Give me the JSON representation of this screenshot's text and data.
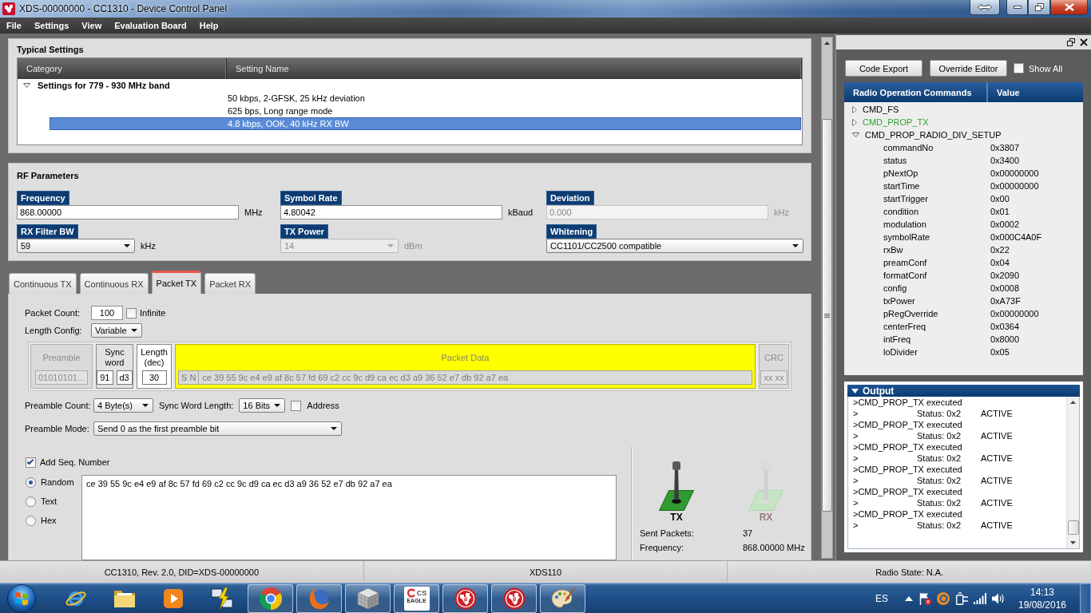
{
  "window": {
    "title": "XDS-00000000 - CC1310 - Device Control Panel"
  },
  "menu": [
    "File",
    "Settings",
    "View",
    "Evaluation Board",
    "Help"
  ],
  "typical_settings": {
    "title": "Typical Settings",
    "columns": [
      "Category",
      "Setting Name"
    ],
    "groups": [
      {
        "label": "Settings for 779 - 930 MHz band",
        "expanded": true,
        "children": [
          {
            "label": "50 kbps, 2-GFSK, 25 kHz deviation",
            "selected": false
          },
          {
            "label": "625 bps, Long range mode",
            "selected": false
          },
          {
            "label": "4.8 kbps, OOK, 40 kHz RX BW",
            "selected": true
          }
        ]
      }
    ]
  },
  "rf_parameters": {
    "title": "RF Parameters",
    "fields": [
      {
        "label": "Frequency",
        "kind": "input",
        "value": "868.00000",
        "unit": "MHz",
        "disabled": false
      },
      {
        "label": "Symbol Rate",
        "kind": "input",
        "value": "4.80042",
        "unit": "kBaud",
        "disabled": false
      },
      {
        "label": "Deviation",
        "kind": "input",
        "value": "0.000",
        "unit": "kHz",
        "disabled": true
      },
      {
        "label": "RX Filter BW",
        "kind": "select",
        "value": "59",
        "unit": "kHz",
        "disabled": false
      },
      {
        "label": "TX Power",
        "kind": "select",
        "value": "14",
        "unit": "dBm",
        "disabled": true
      },
      {
        "label": "Whitening",
        "kind": "select",
        "value": "CC1101/CC2500 compatible",
        "disabled": false
      }
    ]
  },
  "tabs": [
    {
      "label": "Continuous TX",
      "selected": false
    },
    {
      "label": "Continuous RX",
      "selected": false
    },
    {
      "label": "Packet TX",
      "selected": true
    },
    {
      "label": "Packet RX",
      "selected": false
    }
  ],
  "packet_tx": {
    "packet_count": {
      "label": "Packet Count:",
      "value": "100"
    },
    "infinite": {
      "label": "Infinite",
      "checked": false
    },
    "length_config": {
      "label": "Length Config:",
      "value": "Variable"
    },
    "structure": [
      {
        "kind": "preamble",
        "title": "Preamble",
        "values": [
          "01010101..."
        ]
      },
      {
        "kind": "sync",
        "title": "Sync word",
        "values": [
          "91",
          "d3"
        ]
      },
      {
        "kind": "length",
        "title": "Length (dec)",
        "values": [
          "30"
        ]
      },
      {
        "kind": "data",
        "title": "Packet Data",
        "prefix": "S N",
        "values": [
          "ce 39 55 9c e4 e9 af 8c 57 fd 69 c2 cc 9c d9 ca ec d3 a9 36 52 e7 db 92 a7 ea"
        ]
      },
      {
        "kind": "crc",
        "title": "CRC",
        "values": [
          "xx xx"
        ]
      }
    ],
    "preamble_count": {
      "label": "Preamble Count:",
      "value": "4 Byte(s)"
    },
    "sync_word_length": {
      "label": "Sync Word Length:",
      "value": "16 Bits"
    },
    "address": {
      "label": "Address",
      "checked": false
    },
    "preamble_mode": {
      "label": "Preamble Mode:",
      "value": "Send 0 as the first preamble bit"
    },
    "add_seq_number": {
      "label": "Add Seq. Number",
      "checked": true
    },
    "payload_modes": [
      {
        "label": "Random",
        "selected": true
      },
      {
        "label": "Text",
        "selected": false
      },
      {
        "label": "Hex",
        "selected": false
      }
    ],
    "payload": "ce 39 55 9c e4 e9 af 8c 57 fd 69 c2 cc 9c d9 ca ec d3 a9 36 52 e7 db 92 a7 ea",
    "modes": [
      {
        "label": "TX",
        "selected": true
      },
      {
        "label": "RX",
        "selected": false
      }
    ],
    "stats": [
      {
        "label": "Sent Packets:",
        "value": "37"
      },
      {
        "label": "Frequency:",
        "value": "868.00000 MHz"
      }
    ]
  },
  "radio_commands": {
    "buttons": [
      "Code Export",
      "Override Editor"
    ],
    "show_all": {
      "label": "Show All",
      "checked": false
    },
    "columns": [
      "Radio Operation Commands",
      "Value"
    ],
    "commands": [
      {
        "name": "CMD_FS",
        "expanded": false,
        "color": "#000000"
      },
      {
        "name": "CMD_PROP_TX",
        "expanded": false,
        "color": "#2fa32f"
      },
      {
        "name": "CMD_PROP_RADIO_DIV_SETUP",
        "expanded": true,
        "color": "#000000",
        "children": [
          {
            "name": "commandNo",
            "value": "0x3807"
          },
          {
            "name": "status",
            "value": "0x3400"
          },
          {
            "name": "pNextOp",
            "value": "0x00000000"
          },
          {
            "name": "startTime",
            "value": "0x00000000"
          },
          {
            "name": "startTrigger",
            "value": "0x00"
          },
          {
            "name": "condition",
            "value": "0x01"
          },
          {
            "name": "modulation",
            "value": "0x0002"
          },
          {
            "name": "symbolRate",
            "value": "0x000C4A0F"
          },
          {
            "name": "rxBw",
            "value": "0x22"
          },
          {
            "name": "preamConf",
            "value": "0x04"
          },
          {
            "name": "formatConf",
            "value": "0x2090"
          },
          {
            "name": "config",
            "value": "0x0008"
          },
          {
            "name": "txPower",
            "value": "0xA73F"
          },
          {
            "name": "pRegOverride",
            "value": "0x00000000"
          },
          {
            "name": "centerFreq",
            "value": "0x0364"
          },
          {
            "name": "intFreq",
            "value": "0x8000"
          },
          {
            "name": "loDivider",
            "value": "0x05"
          }
        ]
      }
    ]
  },
  "output": {
    "title": "Output",
    "expanded": true,
    "lines": [
      {
        "kind": "message",
        "text": ">CMD_PROP_TX executed"
      },
      {
        "kind": "status",
        "prompt": ">",
        "status": "Status: 0x2",
        "state": "ACTIVE"
      },
      {
        "kind": "message",
        "text": ">CMD_PROP_TX executed"
      },
      {
        "kind": "status",
        "prompt": ">",
        "status": "Status: 0x2",
        "state": "ACTIVE"
      },
      {
        "kind": "message",
        "text": ">CMD_PROP_TX executed"
      },
      {
        "kind": "status",
        "prompt": ">",
        "status": "Status: 0x2",
        "state": "ACTIVE"
      },
      {
        "kind": "message",
        "text": ">CMD_PROP_TX executed"
      },
      {
        "kind": "status",
        "prompt": ">",
        "status": "Status: 0x2",
        "state": "ACTIVE"
      },
      {
        "kind": "message",
        "text": ">CMD_PROP_TX executed"
      },
      {
        "kind": "status",
        "prompt": ">",
        "status": "Status: 0x2",
        "state": "ACTIVE"
      },
      {
        "kind": "message",
        "text": ">CMD_PROP_TX executed"
      },
      {
        "kind": "status",
        "prompt": ">",
        "status": "Status: 0x2",
        "state": "ACTIVE"
      }
    ]
  },
  "status_bar": [
    "CC1310, Rev. 2.0, DID=XDS-00000000",
    "XDS110",
    "Radio State: N.A."
  ],
  "taskbar": {
    "apps": [
      {
        "kind": "e-browser",
        "running": false
      },
      {
        "kind": "folder",
        "running": false
      },
      {
        "kind": "media",
        "running": false
      },
      {
        "kind": "remote",
        "running": false
      },
      {
        "kind": "ring-browser",
        "running": true
      },
      {
        "kind": "fox-browser",
        "running": true
      },
      {
        "kind": "cube",
        "running": true
      },
      {
        "kind": "eagle",
        "running": true,
        "texts": [
          "CS",
          "EAGLE"
        ]
      },
      {
        "kind": "emblem",
        "running": true
      },
      {
        "kind": "emblem",
        "running": true
      },
      {
        "kind": "palette",
        "running": true
      }
    ],
    "tray": {
      "language": "ES",
      "time": "14:13",
      "date": "19/08/2016"
    }
  }
}
